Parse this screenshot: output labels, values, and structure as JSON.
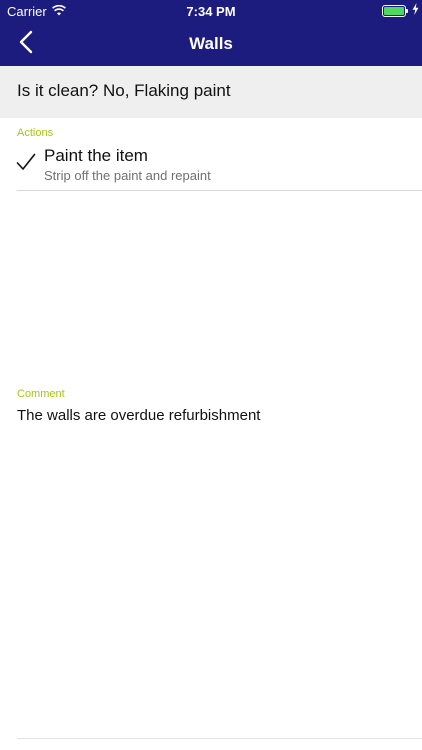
{
  "status_bar": {
    "carrier": "Carrier",
    "time": "7:34 PM",
    "battery_level": 1.0
  },
  "nav": {
    "title": "Walls",
    "back_icon": "chevron-left-icon"
  },
  "question": {
    "text": "Is it clean? No, Flaking paint"
  },
  "actions": {
    "label": "Actions",
    "items": [
      {
        "title": "Paint the item",
        "subtitle": "Strip off the paint and repaint",
        "checked": true
      }
    ]
  },
  "comment": {
    "label": "Comment",
    "text": "The walls are overdue refurbishment"
  },
  "colors": {
    "nav_background": "#1c1b7e",
    "accent_label": "#a9c41a",
    "banner_background": "#efefef",
    "battery_fill": "#4cd964"
  }
}
